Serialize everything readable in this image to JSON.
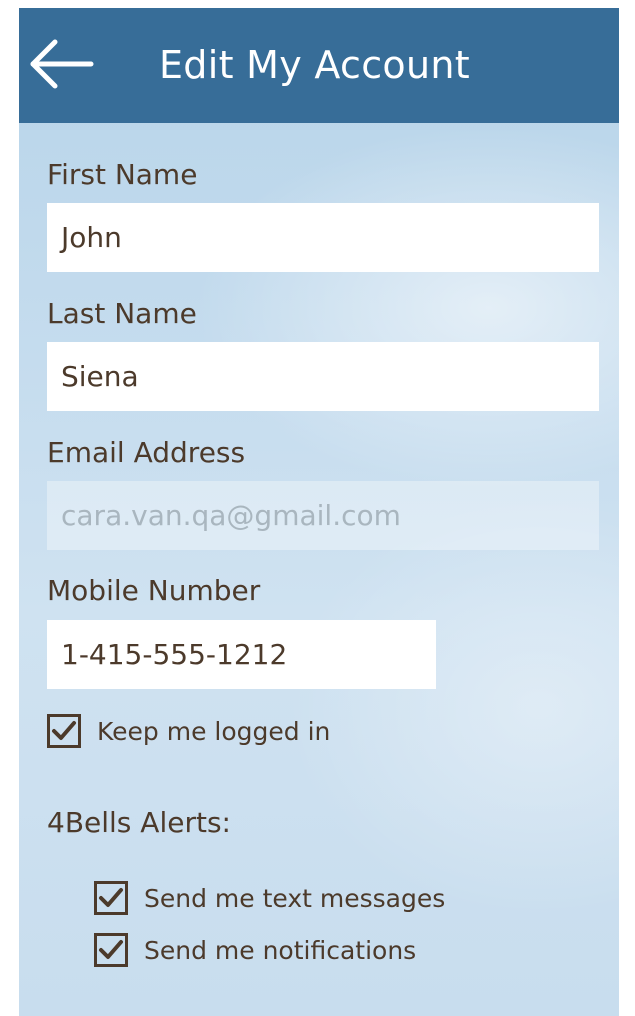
{
  "header": {
    "title": "Edit My Account",
    "back_icon": "arrow-left-icon"
  },
  "form": {
    "first_name": {
      "label": "First Name",
      "value": "John"
    },
    "last_name": {
      "label": "Last Name",
      "value": "Siena"
    },
    "email": {
      "label": "Email Address",
      "value": "cara.van.qa@gmail.com",
      "disabled": true
    },
    "mobile": {
      "label": "Mobile Number",
      "value": "1-415-555-1212"
    },
    "keep_logged_in": {
      "label": "Keep me logged in",
      "checked": true
    }
  },
  "alerts": {
    "heading": "4Bells Alerts:",
    "options": [
      {
        "label": "Send me text messages",
        "checked": true
      },
      {
        "label": "Send me notifications",
        "checked": true
      }
    ]
  },
  "colors": {
    "header_bg": "#376d98",
    "text": "#4c3a2b",
    "background": "#c5dcee"
  }
}
